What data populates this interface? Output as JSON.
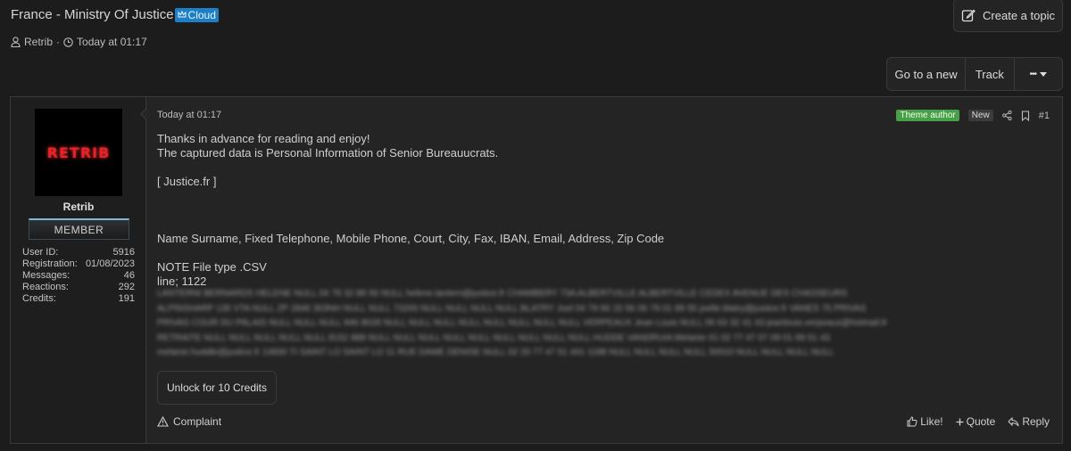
{
  "thread": {
    "title": "France - Ministry Of Justice",
    "prefix": "Cloud",
    "author": "Retrib",
    "separator": "·",
    "date": "Today at 01:17"
  },
  "header": {
    "create_topic": "Create a topic",
    "go_to_new": "Go to a new",
    "track": "Track",
    "more": "•••"
  },
  "user": {
    "avatar_text": "RETRIB",
    "name": "Retrib",
    "banner": "MEMBER",
    "stats": [
      {
        "label": "User ID:",
        "value": "5916"
      },
      {
        "label": "Registration:",
        "value": "01/08/2023"
      },
      {
        "label": "Messages:",
        "value": "46"
      },
      {
        "label": "Reactions:",
        "value": "292"
      },
      {
        "label": "Credits:",
        "value": "191"
      }
    ]
  },
  "post": {
    "date": "Today at 01:17",
    "badge_theme": "Theme author",
    "badge_new": "New",
    "number": "#1",
    "lines": [
      "Thanks in advance for reading and enjoy!",
      "The captured data is Personal Information of Senior Bureauucrats.",
      "",
      "[ Justice.fr ]",
      "",
      "",
      "",
      "Name Surname, Fixed Telephone, Mobile Phone, Court, City, Fax, IBAN, Email, Address, Zip Code",
      "",
      "NOTE File type .CSV",
      "line; 1122"
    ],
    "blurred_lines": [
      "LANTERNI BERNARDS HELENE NULL 04 79 32 88 56 NULL helene.lantern@justice.fr CHAMBERY 73A ALBERTVILLE ALBERTVILLE CEDEX AVENUE DES CHASSEURS",
      "ALPINSHARP 135 VTA NULL ZP 2846 303NH NULL NULL 73200 NULL NULL NULL NULL BLATRY Joel 04 79 66 15 56 06 79 01 89 55 joelle.blatry@justice.fr VANES 75 PRIVAS",
      "PRIVAS COUR DU PALAIS NULL NULL NULL 946 8028 NULL NULL NULL NULL NULL NULL NULL NULL VERPEAUX Jean Louis NULL 06 63 32 41 43 jeanlouis.verpeaux@hotmail.fr",
      "RETRAITE NULL NULL NULL NULL NULL 8152 888 NULL NULL NULL NULL NULL NULL NULL NULL NULL HUDDE VANDRUIA Melanie 01 02 77 47 07 09 01 69 51 43",
      "melanie.huddle@justice.fr 14830 TI SAINT LO SAINT LO 11 RUE DAME DENISE NULL 02 33 77 47 51 441 1188 NULL NULL NULL NULL 50010 NULL NULL NULL NULL"
    ],
    "unlock": "Unlock for 10 Credits",
    "complaint": "Complaint",
    "like": "Like!",
    "quote": "Quote",
    "reply": "Reply"
  }
}
